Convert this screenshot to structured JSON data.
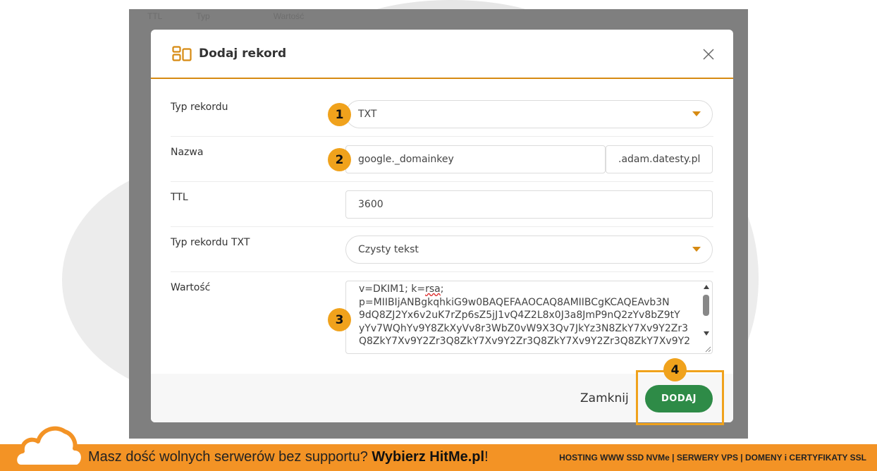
{
  "background_table": {
    "headers": [
      "TTL",
      "Typ",
      "Wartość"
    ]
  },
  "modal": {
    "title": "Dodaj rekord",
    "icon": "layout-icon",
    "close_icon": "close-icon",
    "accent_color": "#d68a12"
  },
  "form": {
    "record_type": {
      "label": "Typ rekordu",
      "value": "TXT",
      "badge": "1"
    },
    "name": {
      "label": "Nazwa",
      "value": "google._domainkey",
      "suffix": ".adam.datesty.pl",
      "badge": "2"
    },
    "ttl": {
      "label": "TTL",
      "value": "3600"
    },
    "txt_type": {
      "label": "Typ rekordu TXT",
      "value": "Czysty tekst"
    },
    "value": {
      "label": "Wartość",
      "badge": "3",
      "line1_prefix": "v=DKIM1; k=",
      "line1_flagged": "rsa",
      "line1_suffix": ";",
      "lines": [
        "p=MIIBIjANBgkqhkiG9w0BAQEFAAOCAQ8AMIIBCgKCAQEAvb3N",
        "9dQ8ZJ2Yx6v2uK7rZp6sZ5jJ1vQ4Z2L8x0J3a8JmP9nQ2zYv8bZ9tY",
        "yYv7WQhYv9Y8ZkXyVv8r3WbZ0vW9X3Qv7JkYz3N8ZkY7Xv9Y2Zr3",
        "Q8ZkY7Xv9Y2Zr3Q8ZkY7Xv9Y2Zr3Q8ZkY7Xv9Y2Zr3Q8ZkY7Xv9Y2"
      ]
    }
  },
  "footer": {
    "close_label": "Zamknij",
    "add_label": "DODAJ",
    "add_badge": "4",
    "add_color": "#2e8b47"
  },
  "banner": {
    "text_prefix": "Masz dość wolnych serwerów bez supportu? ",
    "text_bold": "Wybierz HitMe.pl",
    "text_suffix": "!",
    "right_text": "HOSTING WWW SSD NVMe | SERWERY VPS | DOMENY i CERTYFIKATY SSL",
    "color": "#f39325",
    "logo": "cloud-icon"
  }
}
